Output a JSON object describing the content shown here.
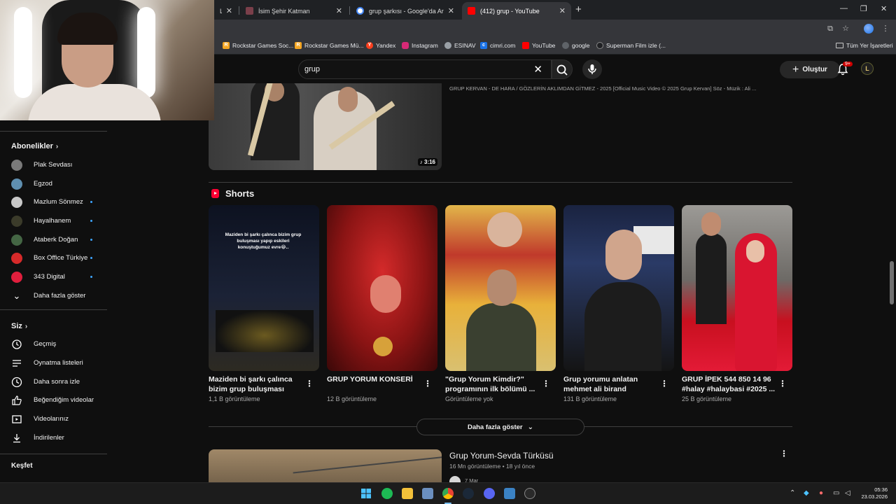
{
  "browser": {
    "tabs": [
      {
        "title": "Lı",
        "active": false
      },
      {
        "title": "İsim Şehir Katman",
        "active": false
      },
      {
        "title": "grup şarkısı - Google'da Ara",
        "active": false
      },
      {
        "title": "(412) grup - YouTube",
        "active": true
      }
    ],
    "bookmarks": [
      {
        "label": "Rockstar Games Soc...",
        "icon": "rockstar-icon",
        "color": "#f5a623"
      },
      {
        "label": "Rockstar Games Mü...",
        "icon": "rockstar-icon",
        "color": "#f5a623"
      },
      {
        "label": "Yandex",
        "icon": "yandex-icon",
        "color": "#fc3f1d"
      },
      {
        "label": "Instagram",
        "icon": "instagram-icon",
        "color": "#d62976"
      },
      {
        "label": "ESINAV",
        "icon": "globe-icon",
        "color": "#9aa0a6"
      },
      {
        "label": "cimri.com",
        "icon": "cimri-icon",
        "color": "#1a73e8"
      },
      {
        "label": "YouTube",
        "icon": "youtube-icon",
        "color": "#ff0000"
      },
      {
        "label": "google",
        "icon": "google-icon",
        "color": "#5f6368"
      },
      {
        "label": "Superman Film izle (...",
        "icon": "superman-icon",
        "color": "#202124"
      }
    ],
    "all_bookmarks": "Tüm Yer İşaretleri"
  },
  "youtube": {
    "search_value": "grup",
    "create_label": "Oluştur",
    "notif_badge": "9+",
    "account_initial": "L"
  },
  "sidebar": {
    "subs_title": "Abonelikler",
    "subs": [
      {
        "label": "Plak Sevdası",
        "color": "#7a7a7a",
        "dot": false
      },
      {
        "label": "Egzod",
        "color": "#5f8fb0",
        "dot": false
      },
      {
        "label": "Mazlum Sönmez",
        "color": "#c8c8c8",
        "dot": true
      },
      {
        "label": "Hayalhanem",
        "color": "#3b3b2a",
        "dot": true
      },
      {
        "label": "Ataberk Doğan",
        "color": "#446644",
        "dot": true
      },
      {
        "label": "Box Office Türkiye",
        "color": "#d62a2a",
        "dot": true
      },
      {
        "label": "343 Digital",
        "color": "#e01f3d",
        "dot": true
      }
    ],
    "more_label": "Daha fazla göster",
    "you_title": "Siz",
    "you_items": [
      {
        "label": "Geçmiş",
        "icon": "history-icon"
      },
      {
        "label": "Oynatma listeleri",
        "icon": "playlist-icon"
      },
      {
        "label": "Daha sonra izle",
        "icon": "clock-icon"
      },
      {
        "label": "Beğendiğim videolar",
        "icon": "like-icon"
      },
      {
        "label": "Videolarınız",
        "icon": "your-videos-icon"
      },
      {
        "label": "İndirilenler",
        "icon": "download-icon"
      }
    ],
    "explore_title": "Keşfet"
  },
  "top_video": {
    "duration": "3:16",
    "desc": "GRUP KERVAN - DE HARA / GÖZLERİN AKLIMDAN GİTMEZ - 2025 [Official Music Video © 2025 Grup Kervan] Söz - Müzik : Ali ..."
  },
  "shorts": {
    "title": "Shorts",
    "items": [
      {
        "title": "Maziden bi şarkı çalınca bizim grup buluşması yapı...",
        "views": "1,1 B görüntüleme",
        "overlay": "Maziden bi şarkı çalınca bizim grup buluşması yapıp eskileri konuştuğumuz evre😂..",
        "bg": "#121826"
      },
      {
        "title": "GRUP YORUM KONSERİ",
        "views": "12 B görüntüleme",
        "overlay": "",
        "bg": "#8b1414"
      },
      {
        "title": "\"Grup Yorum Kimdir?\" programının ilk bölümü ...",
        "views": "Görüntüleme yok",
        "overlay": "",
        "bg": "#c0392b"
      },
      {
        "title": "Grup yorumu anlatan mehmet ali birand",
        "views": "131 B görüntüleme",
        "overlay": "",
        "bg": "#1a2340"
      },
      {
        "title": "GRUP İPEK 544 850 14 96 #halay #halaybasi #2025 ...",
        "views": "25 B görüntüleme",
        "overlay": "",
        "bg": "#b3102a"
      }
    ],
    "more_label": "Daha fazla göster"
  },
  "bottom_video": {
    "title": "Grup Yorum-Sevda Türküsü",
    "meta": "16 Mn görüntüleme • 18 yıl önce",
    "channel": "7 Mar"
  },
  "taskbar": {
    "time": "05:36",
    "date": "23.03.2026"
  }
}
